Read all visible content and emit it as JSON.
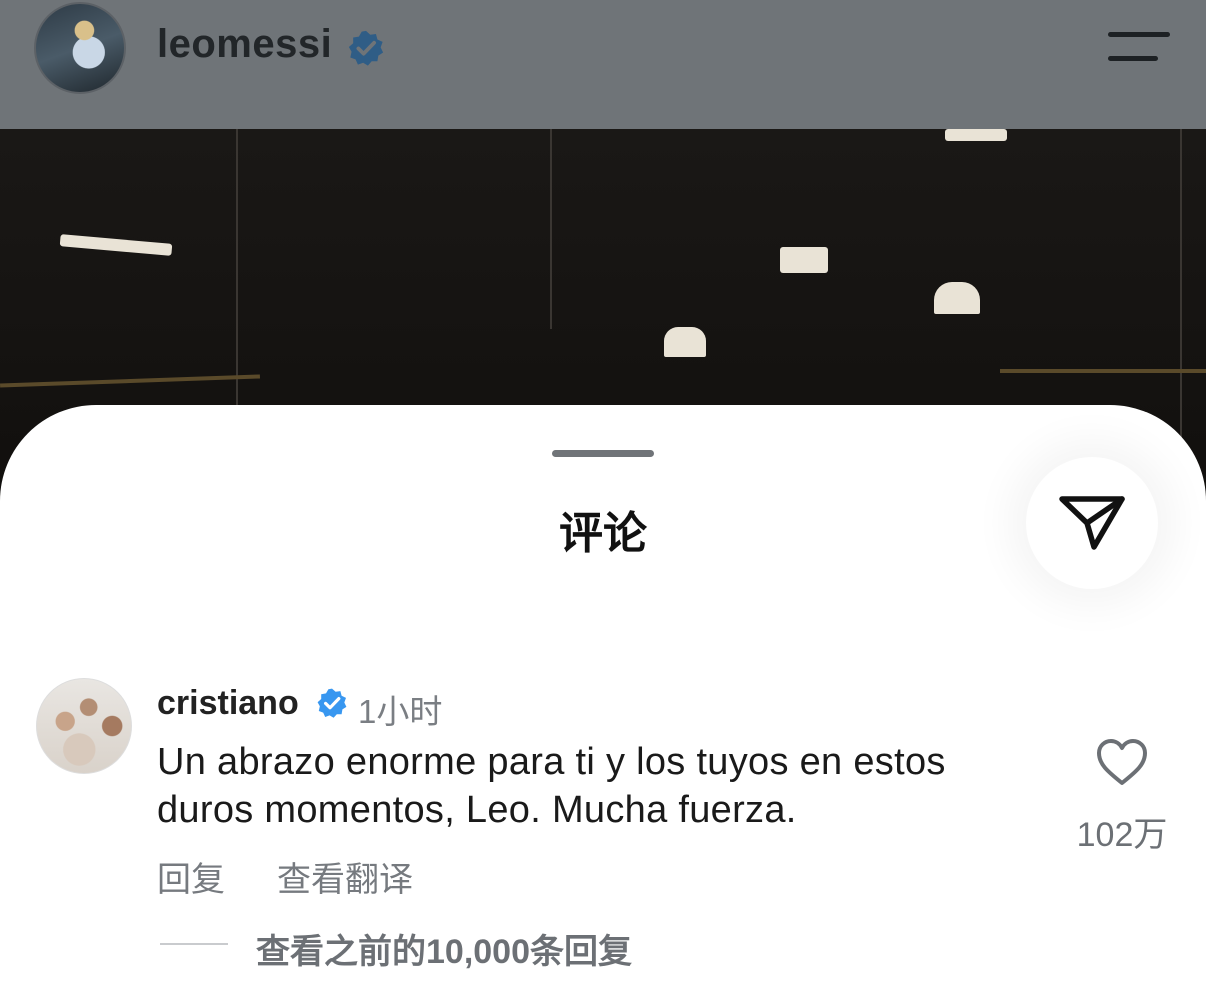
{
  "header": {
    "username": "leomessi",
    "verified_icon": "verified-badge-icon",
    "menu_icon": "menu-icon"
  },
  "sheet": {
    "title": "评论",
    "share_icon": "send-icon"
  },
  "comment": {
    "username": "cristiano",
    "time": "1小时",
    "text": "Un abrazo enorme para ti y los tuyos en estos duros momentos, Leo. Mucha fuerza.",
    "reply_label": "回复",
    "translate_label": "查看翻译",
    "like_count": "102万",
    "view_replies": "查看之前的10,000条回复"
  },
  "colors": {
    "verified_blue": "#3897f0",
    "header_overlay": "#6f7478",
    "secondary_text": "#767a7f"
  }
}
